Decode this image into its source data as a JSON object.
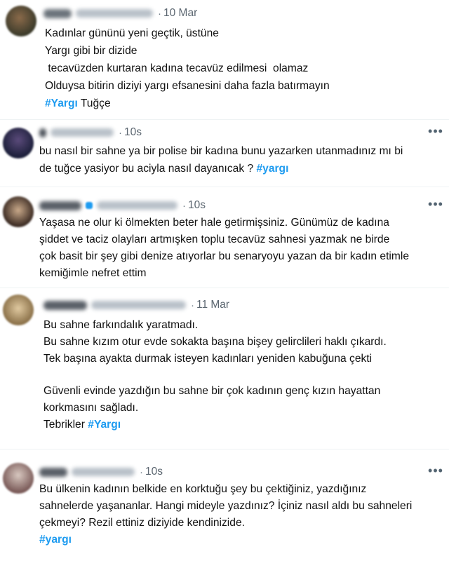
{
  "tweets": [
    {
      "time": "10 Mar",
      "lines": [
        "Kadınlar gününü yeni geçtik, üstüne",
        "Yargı gibi bir dizide",
        " tecavüzden kurtaran kadına tecavüz edilmesi  olamaz",
        "Olduysa bitirin diziyi yargı efsanesini daha fazla batırmayın"
      ],
      "hashtag": "#Yargı",
      "after_tag": " Tuğçe"
    },
    {
      "time": "10s",
      "lines": [
        "bu nasıl bir sahne ya bir polise bir kadına bunu yazarken utanmadınız mı bi",
        "de tuğce yasiyor bu aciyla nasıl dayanıcak ? "
      ],
      "hashtag": "#yargı"
    },
    {
      "time": "10s",
      "lines": [
        "Yaşasa ne olur ki ölmekten beter hale getirmişsiniz. Günümüz de kadına",
        "şiddet ve taciz olayları artmışken toplu tecavüz sahnesi yazmak ne birde",
        "çok basit bir şey gibi denize atıyorlar bu senaryoyu yazan da bir kadın etimle",
        "kemiğimle nefret ettim"
      ]
    },
    {
      "time": "11 Mar",
      "lines": [
        "Bu sahne farkındalık yaratmadı.",
        "Bu sahne kızım otur evde sokakta başına bişey gelirclileri haklı çıkardı.",
        "Tek başına ayakta durmak isteyen kadınları yeniden kabuğuna çekti",
        "Güvenli evinde yazdığın bu sahne bir çok kadının genç kızın hayattan",
        "korkmasını sağladı.",
        "Tebrikler "
      ],
      "hashtag": "#Yargı"
    },
    {
      "time": "10s",
      "lines": [
        "Bu ülkenin kadının belkide en korktuğu şey bu çektiğiniz, yazdığınız",
        "sahnelerde yaşananlar. Hangi mideyle yazdınız? İçiniz nasıl aldı bu sahneleri",
        "çekmeyi? Rezil ettiniz diziyide kendinizide."
      ],
      "hashtag": "#yargı"
    }
  ],
  "icons": {
    "more": "more-horizontal-icon"
  }
}
